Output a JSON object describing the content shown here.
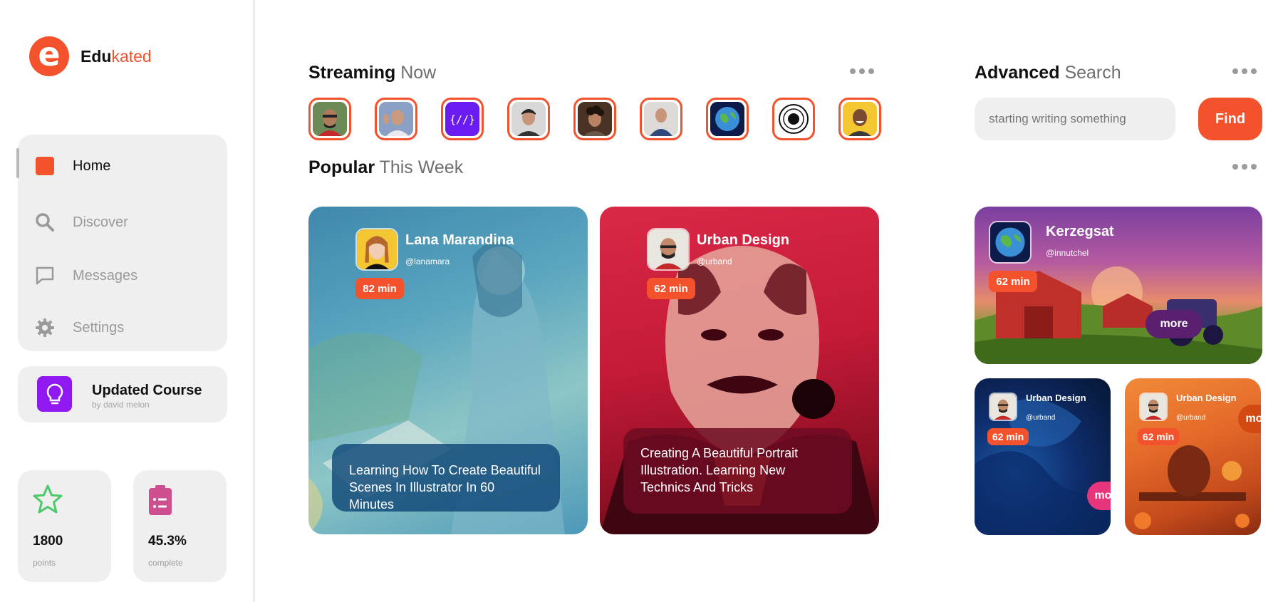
{
  "brand": {
    "logo_letter": "e",
    "name_part1": "Edu",
    "name_part2": "kated",
    "accent": "#f4522d"
  },
  "nav": {
    "items": [
      {
        "label": "Home",
        "icon": "home-square-icon",
        "active": true
      },
      {
        "label": "Discover",
        "icon": "search-icon",
        "active": false
      },
      {
        "label": "Messages",
        "icon": "message-icon",
        "active": false
      },
      {
        "label": "Settings",
        "icon": "gear-icon",
        "active": false
      }
    ]
  },
  "course": {
    "title": "Updated Course",
    "subtitle": "by david melon",
    "icon": "lightbulb-icon",
    "icon_color": "#8f19f0"
  },
  "stats": [
    {
      "value": "1800",
      "label": "points",
      "icon": "star-icon"
    },
    {
      "value": "45.3%",
      "label": "complete",
      "icon": "clipboard-icon"
    }
  ],
  "streaming": {
    "title_bold": "Streaming",
    "title_light": "Now",
    "avatars": [
      {
        "icon": "avatar-man-glasses"
      },
      {
        "icon": "avatar-man-waving"
      },
      {
        "icon": "code-logo-icon"
      },
      {
        "icon": "avatar-man-dark-hair"
      },
      {
        "icon": "avatar-man-curly"
      },
      {
        "icon": "avatar-man-tshirt"
      },
      {
        "icon": "globe-logo-icon"
      },
      {
        "icon": "seal-logo-icon"
      },
      {
        "icon": "avatar-man-smiling"
      }
    ]
  },
  "popular": {
    "title_bold": "Popular",
    "title_light": "This Week",
    "cards": [
      {
        "name": "Lana Marandina",
        "handle": "@lanamara",
        "duration": "82 min",
        "description": "Learning How To Create Beautiful Scenes In Illustrator In 60 Minutes"
      },
      {
        "name": "Urban Design",
        "handle": "@urband",
        "duration": "62 min",
        "description": "Creating A Beautiful Portrait Illustration. Learning New Technics And Tricks"
      }
    ]
  },
  "advanced_search": {
    "title_bold": "Advanced",
    "title_light": "Search",
    "placeholder": "starting writing something",
    "button_label": "Find"
  },
  "side_cards": {
    "featured": {
      "name": "Kerzegsat",
      "handle": "@innutchel",
      "duration": "62 min",
      "more_label": "more"
    },
    "small": [
      {
        "name": "Urban Design",
        "handle": "@urband",
        "duration": "62 min",
        "more_label": "more"
      },
      {
        "name": "Urban Design",
        "handle": "@urband",
        "duration": "62 min",
        "more_label": "more"
      }
    ]
  }
}
